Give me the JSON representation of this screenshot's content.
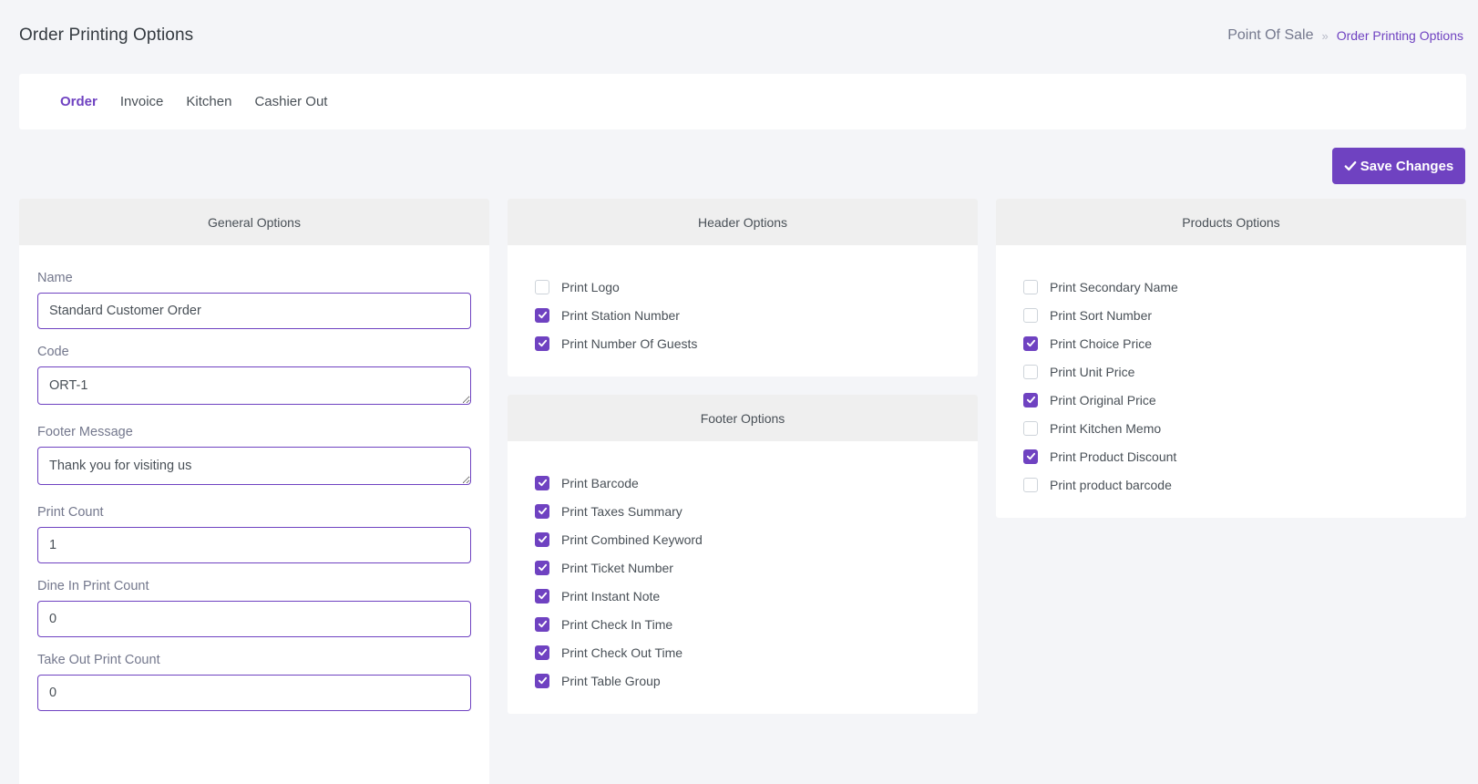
{
  "header": {
    "title": "Order Printing Options",
    "breadcrumb_root": "Point Of Sale",
    "breadcrumb_sep": "»",
    "breadcrumb_current": "Order Printing Options"
  },
  "tabs": [
    {
      "label": "Order",
      "active": true
    },
    {
      "label": "Invoice",
      "active": false
    },
    {
      "label": "Kitchen",
      "active": false
    },
    {
      "label": "Cashier Out",
      "active": false
    }
  ],
  "toolbar": {
    "save_label": "Save Changes",
    "save_icon": "check-icon"
  },
  "colors": {
    "accent": "#6f42c1",
    "header_bg": "#efefef",
    "page_bg": "#f4f5f8"
  },
  "general": {
    "title": "General Options",
    "fields": [
      {
        "label": "Name",
        "value": "Standard Customer Order",
        "type": "input"
      },
      {
        "label": "Code",
        "value": "ORT-1",
        "type": "textarea"
      },
      {
        "label": "Footer Message",
        "value": "Thank you for visiting us",
        "type": "textarea"
      },
      {
        "label": "Print Count",
        "value": "1",
        "type": "input"
      },
      {
        "label": "Dine In Print Count",
        "value": "0",
        "type": "input"
      },
      {
        "label": "Take Out Print Count",
        "value": "0",
        "type": "input"
      }
    ]
  },
  "header_options": {
    "title": "Header Options",
    "items": [
      {
        "label": "Print Logo",
        "checked": false
      },
      {
        "label": "Print Station Number",
        "checked": true
      },
      {
        "label": "Print Number Of Guests",
        "checked": true
      }
    ]
  },
  "footer_options": {
    "title": "Footer Options",
    "items": [
      {
        "label": "Print Barcode",
        "checked": true
      },
      {
        "label": "Print Taxes Summary",
        "checked": true
      },
      {
        "label": "Print Combined Keyword",
        "checked": true
      },
      {
        "label": "Print Ticket Number",
        "checked": true
      },
      {
        "label": "Print Instant Note",
        "checked": true
      },
      {
        "label": "Print Check In Time",
        "checked": true
      },
      {
        "label": "Print Check Out Time",
        "checked": true
      },
      {
        "label": "Print Table Group",
        "checked": true
      }
    ]
  },
  "products_options": {
    "title": "Products Options",
    "items": [
      {
        "label": "Print Secondary Name",
        "checked": false
      },
      {
        "label": "Print Sort Number",
        "checked": false
      },
      {
        "label": "Print Choice Price",
        "checked": true
      },
      {
        "label": "Print Unit Price",
        "checked": false
      },
      {
        "label": "Print Original Price",
        "checked": true
      },
      {
        "label": "Print Kitchen Memo",
        "checked": false
      },
      {
        "label": "Print Product Discount",
        "checked": true
      },
      {
        "label": "Print product barcode",
        "checked": false
      }
    ]
  }
}
